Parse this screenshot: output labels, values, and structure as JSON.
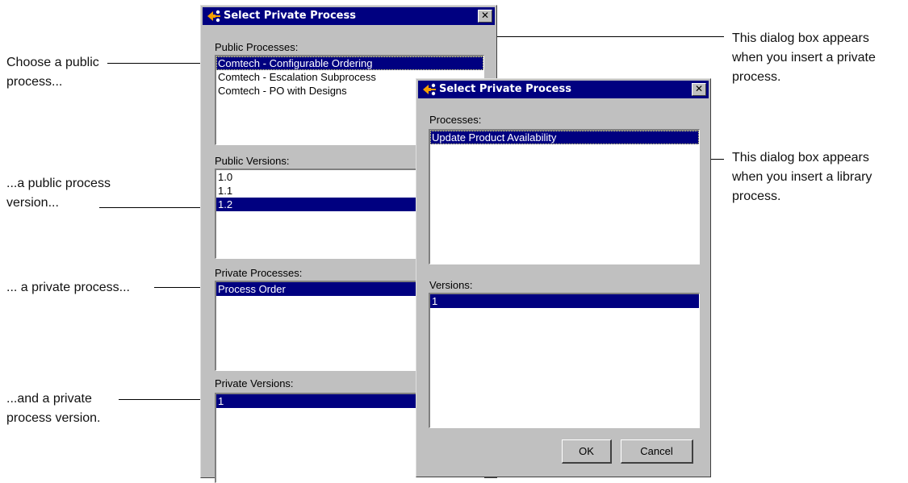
{
  "annotations": {
    "choose_public": "Choose a public\nprocess...",
    "public_version": "...a public process\nversion...",
    "private_process": "... a private process...",
    "private_version": "...and a private\nprocess version.",
    "private_dialog_note": "This dialog box appears\nwhen you insert a private\nprocess.",
    "library_dialog_note": "This dialog box appears\nwhen you insert a library\nprocess."
  },
  "dialog_private": {
    "title": "Select Private Process",
    "close_glyph": "✕",
    "public_processes_label": "Public Processes:",
    "public_processes": [
      {
        "text": "Comtech - Configurable Ordering"
      },
      {
        "text": "Comtech - Escalation Subprocess"
      },
      {
        "text": "Comtech - PO with Designs"
      }
    ],
    "public_versions_label": "Public Versions:",
    "public_versions": [
      {
        "text": "1.0"
      },
      {
        "text": "1.1"
      },
      {
        "text": "1.2"
      }
    ],
    "private_processes_label": "Private Processes:",
    "private_processes": [
      {
        "text": "Process Order"
      }
    ],
    "private_versions_label": "Private Versions:",
    "private_versions": [
      {
        "text": "1"
      }
    ]
  },
  "dialog_library": {
    "title": "Select Private Process",
    "close_glyph": "✕",
    "processes_label": "Processes:",
    "processes": [
      {
        "text": "Update Product Availability"
      }
    ],
    "versions_label": "Versions:",
    "versions": [
      {
        "text": "1"
      }
    ],
    "ok_label": "OK",
    "cancel_label": "Cancel"
  },
  "colors": {
    "title_bar": "#000080",
    "selection": "#000080",
    "dialog_face": "#c0c0c0"
  },
  "icons": {
    "dialog_icon": "process-arrow-icon",
    "close": "close-icon"
  }
}
